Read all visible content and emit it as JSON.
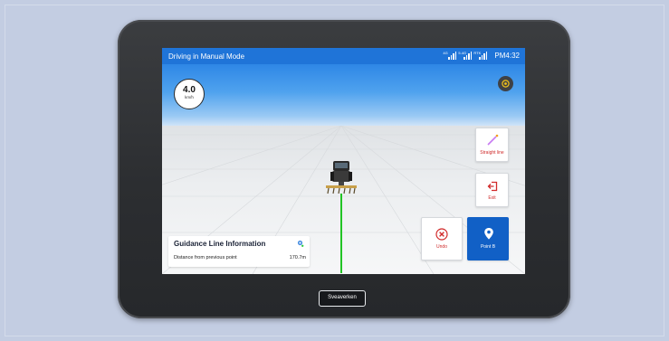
{
  "status_bar": {
    "title": "Driving in Manual Mode",
    "signals": [
      {
        "tag": "4G"
      },
      {
        "tag": "5.4G"
      },
      {
        "tag": "RTK"
      }
    ],
    "time": "PM4:32"
  },
  "speed": {
    "value": "4.0",
    "unit": "km/h"
  },
  "buttons": {
    "straight_line": "Straight line",
    "exit": "Exit",
    "undo": "Undo",
    "point_b": "Point B"
  },
  "guidance": {
    "title": "Guidance Line Information",
    "distance_label": "Distance from previous point",
    "distance_value": "170.7m"
  },
  "brand": "Sveaverken",
  "colors": {
    "accent": "#1f74d8",
    "danger": "#cf2b2b",
    "guide_line": "#22c425",
    "device_frame": "#2c2e31"
  },
  "icons": [
    "gps-locate-icon",
    "pencil-line-icon",
    "exit-door-icon",
    "close-circle-icon",
    "map-pin-icon",
    "map-marker-icon",
    "signal-icon"
  ]
}
